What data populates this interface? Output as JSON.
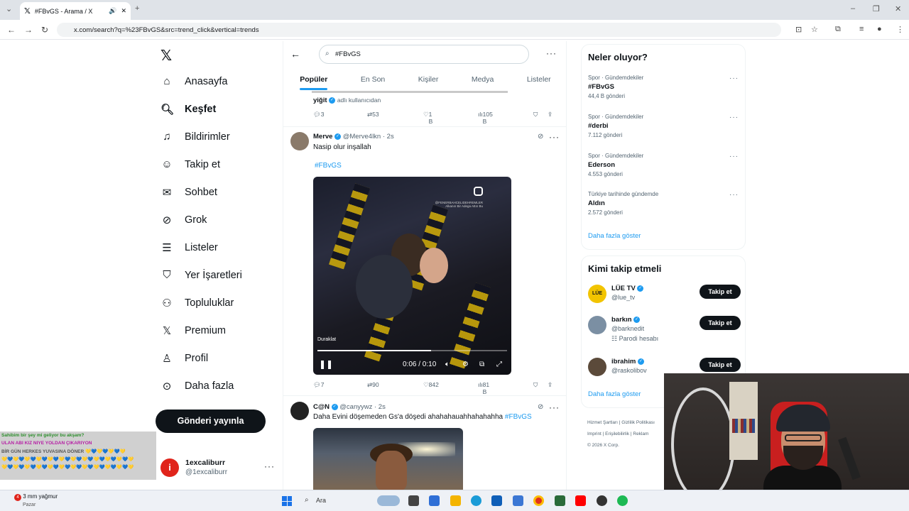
{
  "browser": {
    "tab_title": "#FBvGS - Arama / X",
    "url": "x.com/search?q=%23FBvGS&src=trend_click&vertical=trends"
  },
  "nav": {
    "items": [
      {
        "label": "Anasayfa",
        "icon": "home-icon"
      },
      {
        "label": "Keşfet",
        "icon": "search-icon",
        "active": true
      },
      {
        "label": "Bildirimler",
        "icon": "bell-icon"
      },
      {
        "label": "Takip et",
        "icon": "add-person-icon"
      },
      {
        "label": "Sohbet",
        "icon": "mail-icon"
      },
      {
        "label": "Grok",
        "icon": "grok-icon"
      },
      {
        "label": "Listeler",
        "icon": "list-icon"
      },
      {
        "label": "Yer İşaretleri",
        "icon": "bookmark-icon"
      },
      {
        "label": "Topluluklar",
        "icon": "community-icon"
      },
      {
        "label": "Premium",
        "icon": "x-icon"
      },
      {
        "label": "Profil",
        "icon": "profile-icon"
      },
      {
        "label": "Daha fazla",
        "icon": "more-icon"
      }
    ],
    "post_button": "Gönderi yayınla"
  },
  "account": {
    "initial": "i",
    "name": "1excaliburr",
    "handle": "@1excaliburr"
  },
  "chat": [
    {
      "text": "Sahibim bir şey mi geliyor bu akşam?",
      "color": "#2d8f2d"
    },
    {
      "text": "ULAN ABİ KIZ NİYE YOLDAN ÇIKARIYON",
      "color": "#b61ea5"
    },
    {
      "text": "BİR GÜN HERKES YUVASINA DÖNER 💛💙💛💙💛💙💛",
      "color": "#555555"
    },
    {
      "text": "💛💙💛💙💛💙💛💙💛💙💛💙💛💙💛💙💛💙💛💙💛💙💛",
      "color": "#c9a400"
    },
    {
      "text": "💛💙💛💙💛💙💛💙💛💙💛💙💛💙💛💙💛💙💛💙💛💙💛",
      "color": "#c9a400"
    }
  ],
  "search": {
    "query": "#FBvGS"
  },
  "tabs": [
    "Popüler",
    "En Son",
    "Kişiler",
    "Medya",
    "Listeler"
  ],
  "tweet0": {
    "text_name": "yiğit",
    "text_rest": "adlı kullanıcıdan",
    "replies": "3",
    "reposts": "53",
    "likes": "1 B",
    "views": "105 B"
  },
  "tweet1": {
    "name": "Merve",
    "handle": "@Merve4lkn · 2s",
    "text": "Nasip olur inşallah",
    "hashtag": "#FBvGS",
    "video": {
      "watermark_1": "@FENERBAHCELIDEHREMLER",
      "watermark_2": "Alkanın Bir Adega Attın Bu",
      "caption": "Duraklat",
      "time": "0:06 / 0:10",
      "progress": 0.6
    },
    "replies": "7",
    "reposts": "90",
    "likes": "842",
    "views": "81 B"
  },
  "tweet2": {
    "name": "C@N",
    "handle": "@canyywz · 2s",
    "text": "Daha Evini döşemeden Gs'a döşedi ahahahauahhahahahha",
    "hashtag": "#FBvGS"
  },
  "trends": {
    "title": "Neler oluyor?",
    "items": [
      {
        "category": "Spor · Gündemdekiler",
        "name": "#FBvGS",
        "count": "44,4 B gönderi"
      },
      {
        "category": "Spor · Gündemdekiler",
        "name": "#derbi",
        "count": "7.112 gönderi"
      },
      {
        "category": "Spor · Gündemdekiler",
        "name": "Ederson",
        "count": "4.553 gönderi"
      },
      {
        "category": "Türkiye tarihinde gündemde",
        "name": "Aldın",
        "count": "2.572 gönderi"
      }
    ],
    "show_more": "Daha fazla göster"
  },
  "follow": {
    "title": "Kimi takip etmeli",
    "users": [
      {
        "name": "LÜE TV",
        "handle": "@lue_tv",
        "note": "",
        "avatar_color": "#f2c400",
        "avatar_text": "LÜE"
      },
      {
        "name": "barkın",
        "handle": "@barknedit",
        "note": "Parodi hesabı",
        "avatar_color": "#7b8fa3",
        "avatar_text": ""
      },
      {
        "name": "ibrahim",
        "handle": "@raskolibov",
        "note": "",
        "avatar_color": "#5b4a3a",
        "avatar_text": ""
      }
    ],
    "button": "Takip et",
    "show_more": "Daha fazla göster"
  },
  "footer": {
    "line1": "Hizmet Şartları  |  Gizlilik Politikası",
    "line2": "Imprint  |  Erişilebilirlik  |  Reklam",
    "line3": "© 2026 X Corp."
  },
  "taskbar": {
    "weather_title": "3 mm yağmur",
    "weather_sub": "Pazar",
    "weather_badge": "4",
    "search_placeholder": "Ara"
  },
  "colors": {
    "accent": "#1d9bf0",
    "text": "#0f1419",
    "muted": "#536471"
  }
}
